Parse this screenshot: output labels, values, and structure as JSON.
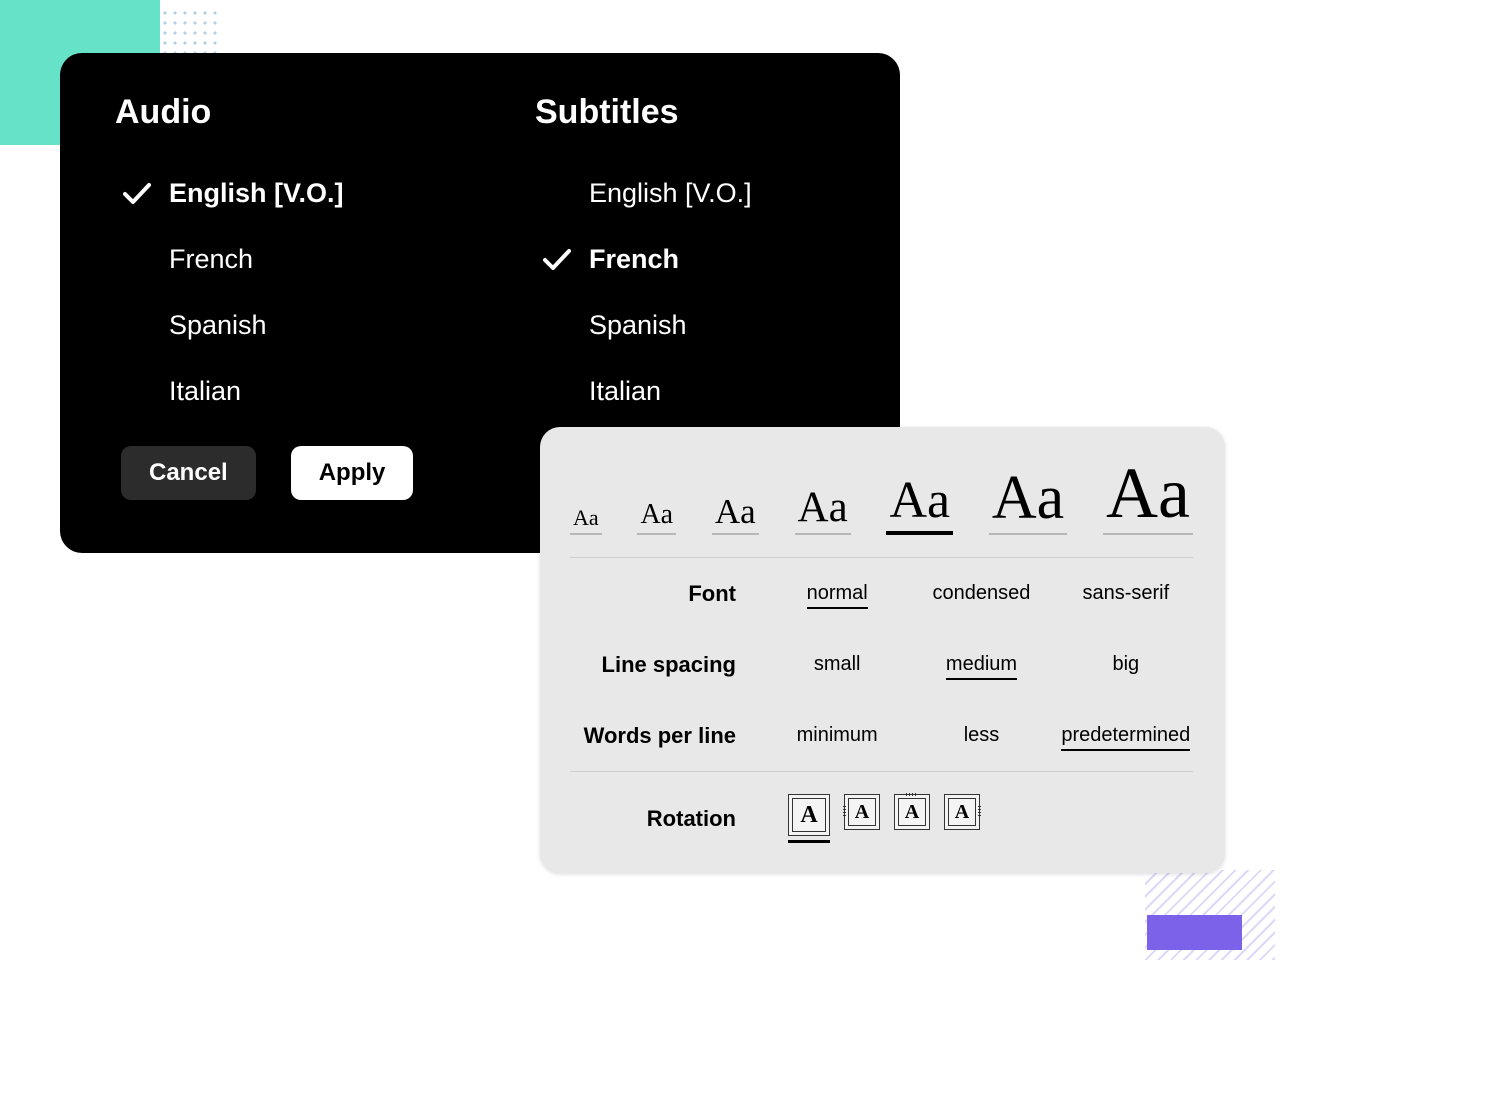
{
  "audio": {
    "heading": "Audio",
    "selected_index": 0,
    "items": [
      {
        "label": "English  [V.O.]"
      },
      {
        "label": "French"
      },
      {
        "label": "Spanish"
      },
      {
        "label": "Italian"
      }
    ]
  },
  "subtitles": {
    "heading": "Subtitles",
    "selected_index": 1,
    "items": [
      {
        "label": "English  [V.O.]"
      },
      {
        "label": "French"
      },
      {
        "label": "Spanish"
      },
      {
        "label": "Italian"
      }
    ]
  },
  "buttons": {
    "cancel": "Cancel",
    "apply": "Apply"
  },
  "textPanel": {
    "sizes": {
      "sample": "Aa",
      "count": 7,
      "selected_index": 4
    },
    "font": {
      "label": "Font",
      "options": [
        "normal",
        "condensed",
        "sans-serif"
      ],
      "selected_index": 0
    },
    "lineSpacing": {
      "label": "Line spacing",
      "options": [
        "small",
        "medium",
        "big"
      ],
      "selected_index": 1
    },
    "wordsPerLine": {
      "label": "Words per line",
      "options": [
        "minimum",
        "less",
        "predetermined"
      ],
      "selected_index": 2
    },
    "rotation": {
      "label": "Rotation",
      "glitch": "A",
      "selected_index": 0
    }
  },
  "colors": {
    "mint": "#66e2c9",
    "purple": "#7c62e8",
    "panel": "#e8e8e8"
  }
}
